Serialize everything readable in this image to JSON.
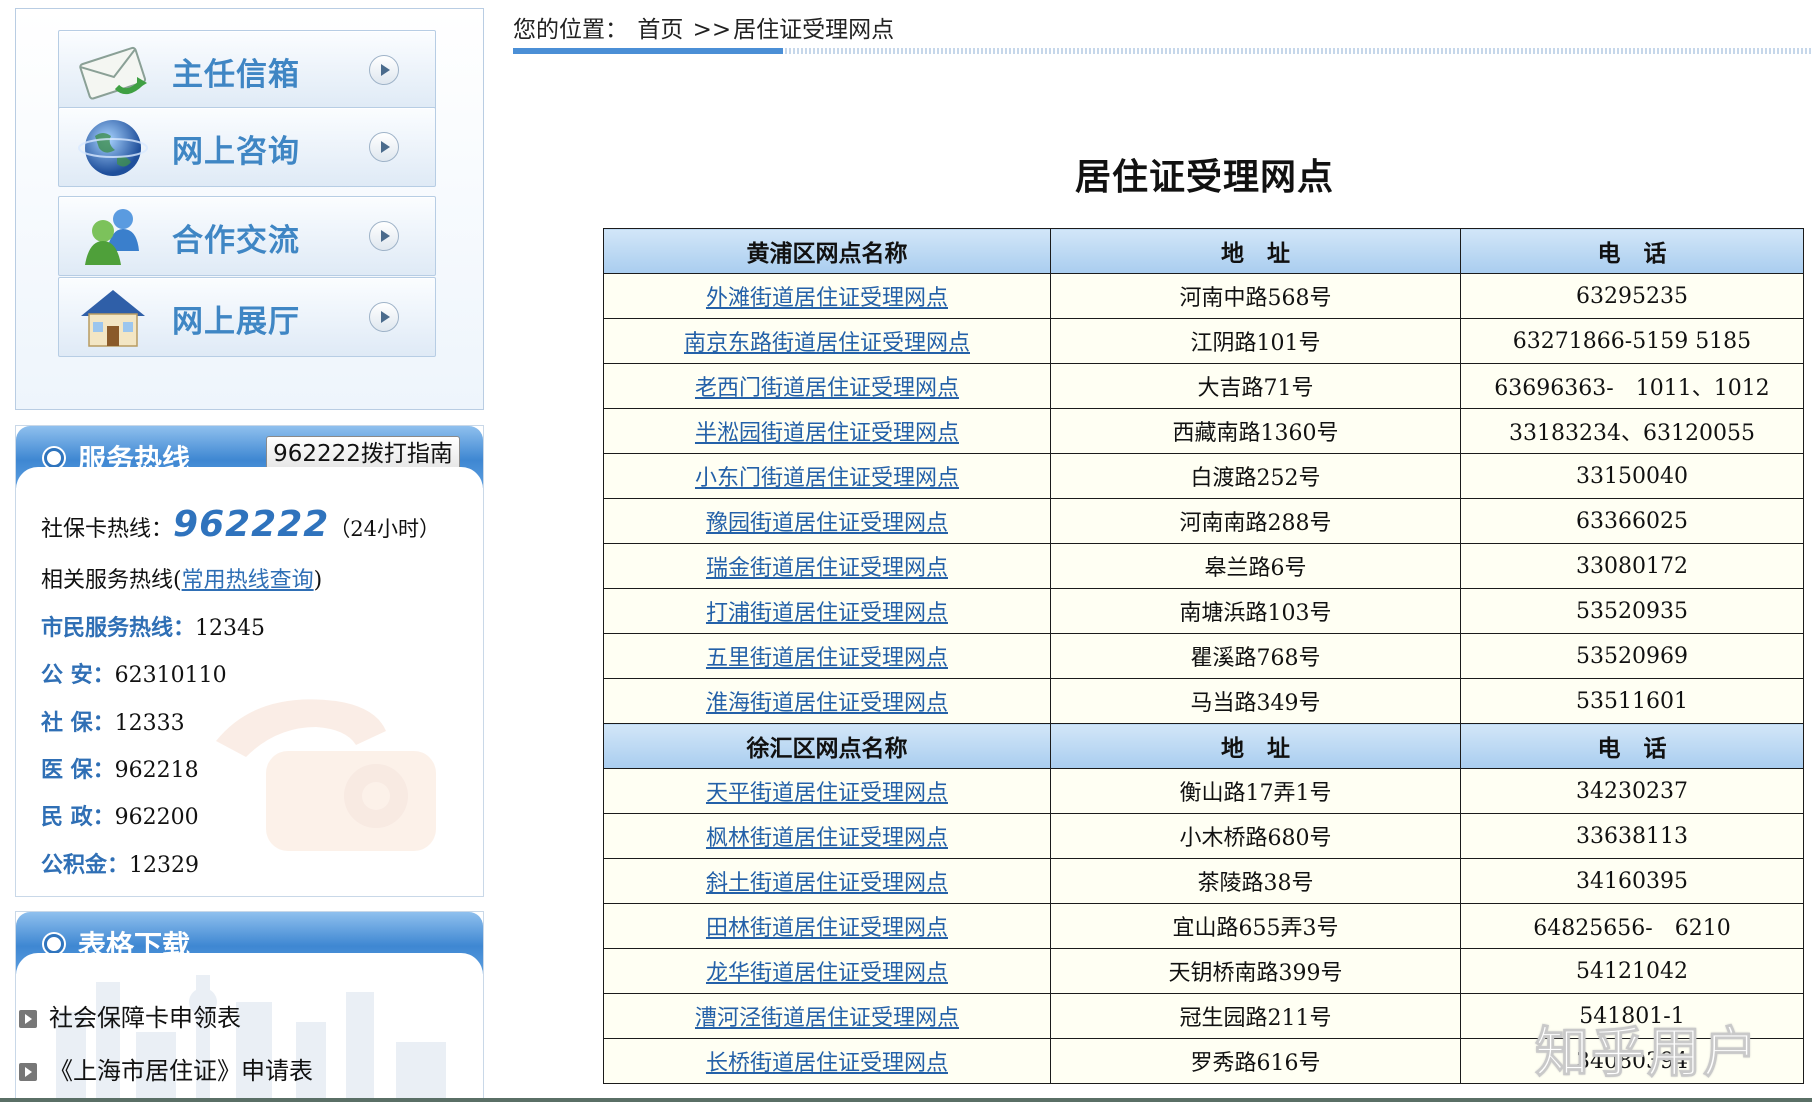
{
  "nav": {
    "items": [
      {
        "label": "主任信箱",
        "icon": "envelope-icon"
      },
      {
        "label": "网上咨询",
        "icon": "globe-icon"
      },
      {
        "label": "合作交流",
        "icon": "people-icon"
      },
      {
        "label": "网上展厅",
        "icon": "house-icon"
      }
    ]
  },
  "hotline": {
    "title": "服务热线",
    "guide_button": "962222拨打指南",
    "card_label": "社保卡热线：",
    "card_number": "962222",
    "card_hours": "（24小时）",
    "related_prefix": "相关服务热线(",
    "related_link": "常用热线查询",
    "related_suffix": ")",
    "lines": [
      {
        "label": "市民服务热线：",
        "value": "12345"
      },
      {
        "label": "公  安：",
        "value": "62310110"
      },
      {
        "label": "社  保：",
        "value": "12333"
      },
      {
        "label": "医  保：",
        "value": "962218"
      },
      {
        "label": "民  政：",
        "value": "962200"
      },
      {
        "label": "公积金：",
        "value": "12329"
      }
    ]
  },
  "downloads": {
    "title": "表格下载",
    "items": [
      {
        "label": "社会保障卡申领表"
      },
      {
        "label": "《上海市居住证》申请表"
      }
    ]
  },
  "breadcrumb": {
    "prefix": "您的位置：",
    "home": "首页",
    "separator": ">>",
    "current": "居住证受理网点"
  },
  "page": {
    "title": "居住证受理网点"
  },
  "table": {
    "sections": [
      {
        "headers": [
          "黄浦区网点名称",
          "地　址",
          "电　话"
        ],
        "rows": [
          [
            "外滩街道居住证受理网点",
            "河南中路568号",
            "63295235"
          ],
          [
            "南京东路街道居住证受理网点",
            "江阴路101号",
            "63271866-5159 5185"
          ],
          [
            "老西门街道居住证受理网点",
            "大吉路71号",
            "63696363-　1011、1012"
          ],
          [
            "半淞园街道居住证受理网点",
            "西藏南路1360号",
            "33183234、63120055"
          ],
          [
            "小东门街道居住证受理网点",
            "白渡路252号",
            "33150040"
          ],
          [
            "豫园街道居住证受理网点",
            "河南南路288号",
            "63366025"
          ],
          [
            "瑞金街道居住证受理网点",
            "皋兰路6号",
            "33080172"
          ],
          [
            "打浦街道居住证受理网点",
            "南塘浜路103号",
            "53520935"
          ],
          [
            "五里街道居住证受理网点",
            "瞿溪路768号",
            "53520969"
          ],
          [
            "淮海街道居住证受理网点",
            "马当路349号",
            "53511601"
          ]
        ]
      },
      {
        "headers": [
          "徐汇区网点名称",
          "地　址",
          "电　话"
        ],
        "rows": [
          [
            "天平街道居住证受理网点",
            "衡山路17弄1号",
            "34230237"
          ],
          [
            "枫林街道居住证受理网点",
            "小木桥路680号",
            "33638113"
          ],
          [
            "斜土街道居住证受理网点",
            "茶陵路38号",
            "34160395"
          ],
          [
            "田林街道居住证受理网点",
            "宜山路655弄3号",
            "64825656-　6210"
          ],
          [
            "龙华街道居住证受理网点",
            "天钥桥南路399号",
            "54121042"
          ],
          [
            "漕河泾街道居住证受理网点",
            "冠生园路211号",
            "541801-1"
          ],
          [
            "长桥街道居住证受理网点",
            "罗秀路616号",
            "34080394"
          ]
        ]
      }
    ]
  },
  "watermark": "知乎用户"
}
